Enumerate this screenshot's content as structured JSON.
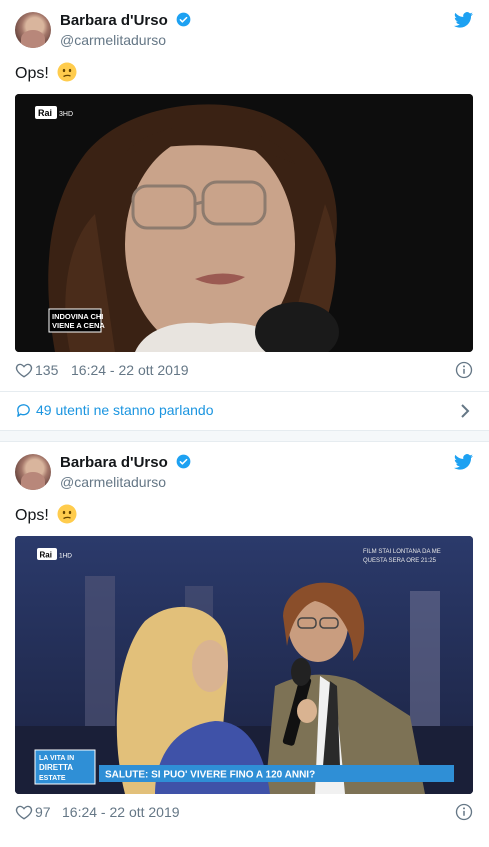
{
  "tweets": [
    {
      "author_name": "Barbara d'Urso",
      "handle": "@carmelitadurso",
      "text": "Ops!",
      "media": {
        "channel_logo": "Rai 3HD",
        "caption": "INDOVINA CHI VIENE A CENA"
      },
      "likes": "135",
      "timestamp": "16:24 - 22 ott 2019",
      "conversation": "49 utenti ne stanno parlando"
    },
    {
      "author_name": "Barbara d'Urso",
      "handle": "@carmelitadurso",
      "text": "Ops!",
      "media": {
        "channel_logo": "Rai 1HD",
        "promo": "FILM STAI LONTANA DA ME QUESTA SERA ORE 21:25",
        "show_logo": "LA VITA IN DIRETTA ESTATE",
        "headline": "SALUTE: SI PUO' VIVERE FINO A 120 ANNI?"
      },
      "likes": "97",
      "timestamp": "16:24 - 22 ott 2019"
    }
  ],
  "colors": {
    "accent": "#1da1f2",
    "link": "#1b95e0",
    "muted": "#657786"
  }
}
